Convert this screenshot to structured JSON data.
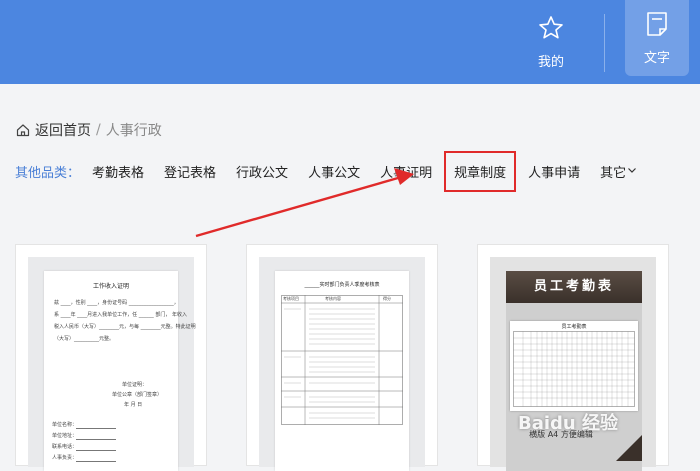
{
  "header": {
    "favorites_label": "我的",
    "docs_label": "文字"
  },
  "breadcrumb": {
    "home_label": "返回首页",
    "separator": "/",
    "current": "人事行政"
  },
  "categories": {
    "label": "其他品类：",
    "items": [
      "考勤表格",
      "登记表格",
      "行政公文",
      "人事公文",
      "人事证明",
      "规章制度",
      "人事申请"
    ],
    "highlighted": "规章制度",
    "more_label": "其它"
  },
  "cards": [
    {
      "title": "工作收入证明",
      "lines": [
        "兹 ____，性别 ____，身份证号码 __________________，",
        "系 ____年 ____月进入我单位工作，任 ______ 部门， 年收入",
        "税入人民币（大写）________元，与每 ________元整。特此证明",
        "（大写）__________元整。"
      ],
      "sign": [
        "单位证明：",
        "单位公章（部门签章）",
        "年   月   日"
      ],
      "fields": [
        "单位名称：",
        "单位地址：",
        "联系电话：",
        "人事负责："
      ]
    },
    {
      "title": "______实时部门负责人季度考核表",
      "header_row": [
        "考核项目",
        "考核内容",
        "得分"
      ]
    },
    {
      "title": "员工考勤表",
      "subtitle": "员工考勤表",
      "footer": "横版 A4   方便编辑",
      "watermark": "Baidu 经验"
    }
  ],
  "colors": {
    "topbar": "#4c86e0",
    "category_label": "#4a7fd6",
    "highlight": "#e02a2a",
    "arrow": "#e02a2a"
  }
}
